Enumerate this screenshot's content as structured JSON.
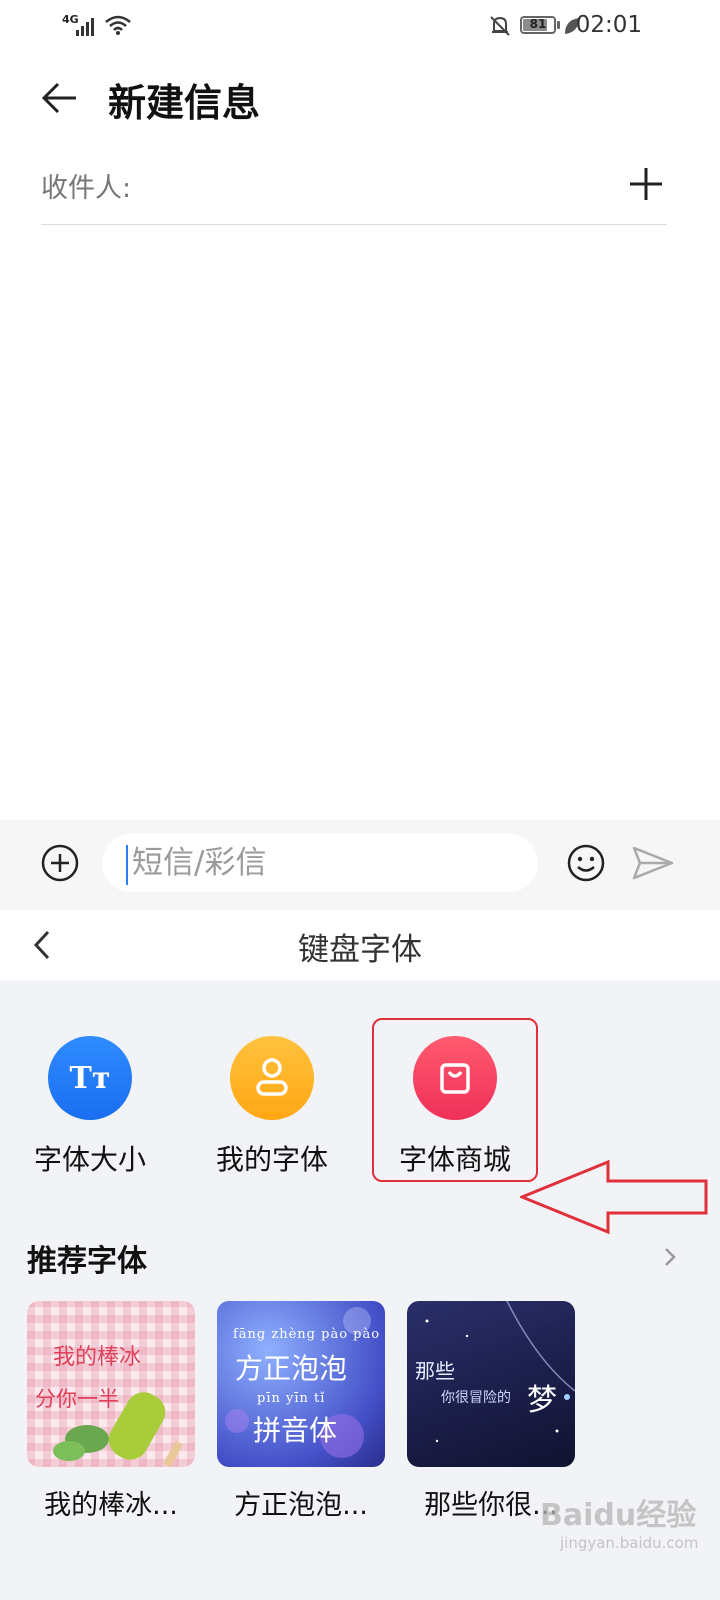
{
  "status_bar": {
    "network": "4G",
    "battery_level": "81",
    "battery_fraction": 0.81,
    "time": "02:01",
    "icons": [
      "signal-icon",
      "wifi-icon",
      "bell-off-icon",
      "battery-icon",
      "leaf-icon"
    ]
  },
  "header": {
    "title": "新建信息",
    "recipient_label": "收件人:"
  },
  "compose": {
    "placeholder": "短信/彩信",
    "value": ""
  },
  "font_panel": {
    "title": "键盘字体",
    "options": [
      {
        "label": "字体大小",
        "icon": "font-size-icon",
        "color": "#1f78f5"
      },
      {
        "label": "我的字体",
        "icon": "person-icon",
        "color": "#ffb21f"
      },
      {
        "label": "字体商城",
        "icon": "shopping-bag-icon",
        "color": "#f43f62"
      }
    ],
    "recommended_title": "推荐字体",
    "cards": [
      {
        "name": "我的棒冰...",
        "preview_lines": [
          "我的棒冰",
          "分你一半"
        ]
      },
      {
        "name": "方正泡泡...",
        "preview_lines": [
          "fāng zhèng pào pào",
          "方正泡泡",
          "pīn yīn tǐ",
          "拼音体"
        ]
      },
      {
        "name": "那些你很...",
        "preview_lines": [
          "那些",
          "你很冒险的",
          "梦"
        ]
      }
    ]
  },
  "annotation": {
    "highlight_color": "#e0303a"
  },
  "watermark": {
    "text": "Baidu经验",
    "sub": "jingyan.baidu.com"
  }
}
